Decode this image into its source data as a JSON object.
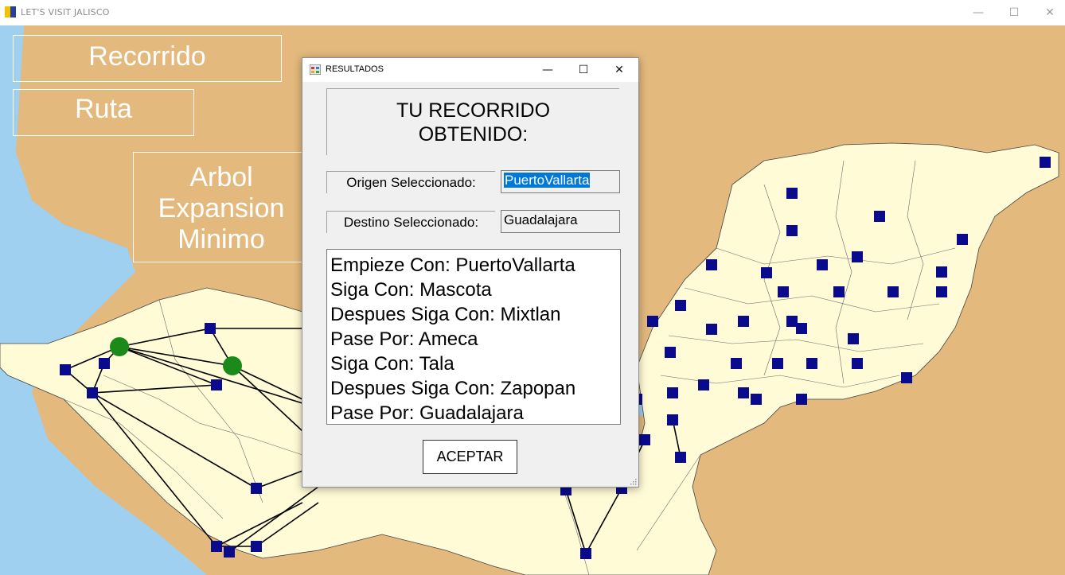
{
  "window": {
    "title": "LET'S VISIT JALISCO",
    "minimize_glyph": "—",
    "maximize_glyph": "☐",
    "close_glyph": "✕"
  },
  "overlay_buttons": {
    "recorrido": "Recorrido",
    "ruta": "Ruta",
    "arbol_line1": "Arbol",
    "arbol_line2": "Expansion",
    "arbol_line3": "Minimo"
  },
  "dialog": {
    "title": "RESULTADOS",
    "minimize_glyph": "—",
    "maximize_glyph": "☐",
    "close_glyph": "✕",
    "heading_line1": "TU RECORRIDO",
    "heading_line2": "OBTENIDO:",
    "origin_label": "Origen Seleccionado:",
    "origin_value": "PuertoVallarta",
    "destination_label": "Destino Seleccionado:",
    "destination_value": "Guadalajara",
    "route_steps": [
      "Empieze Con: PuertoVallarta",
      "Siga Con: Mascota",
      "Despues Siga Con: Mixtlan",
      "Pase Por: Ameca",
      "Siga Con: Tala",
      "Despues Siga Con: Zapopan",
      "Pase Por: Guadalajara"
    ],
    "accept_label": "ACEPTAR"
  },
  "colors": {
    "ocean": "#9fd0f0",
    "jalisco_land": "#fffbd6",
    "other_land": "#e3b97d",
    "node": "#0a0a8c",
    "selected_node": "#1a8a1a"
  }
}
